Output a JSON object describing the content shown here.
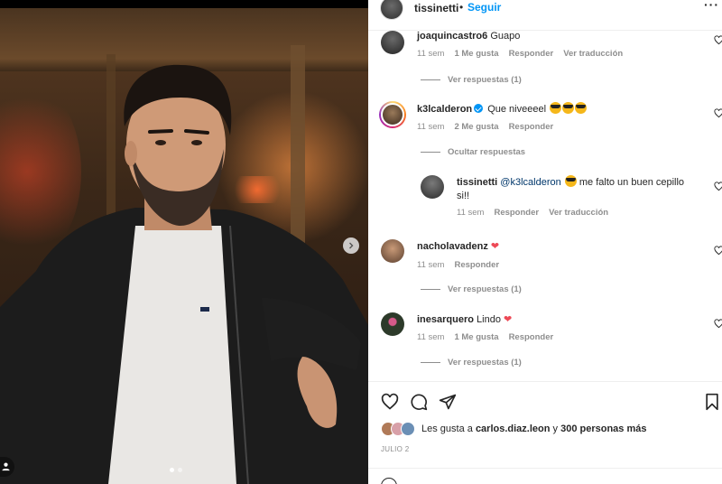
{
  "post": {
    "username": "tissinetti",
    "separator": "•",
    "follow_label": "Seguir",
    "more_label": "···",
    "carousel_dots": 2
  },
  "comments": [
    {
      "username": "joaquincastro6",
      "text": "Guapo",
      "time": "11 sem",
      "likes": "1 Me gusta",
      "reply": "Responder",
      "translate": "Ver traducción",
      "replies_toggle": "Ver respuestas (1)",
      "avatar_color": "#3b3b3b"
    },
    {
      "username": "k3lcalderon",
      "verified": true,
      "text": "Que niveeeel",
      "time": "11 sem",
      "likes": "2 Me gusta",
      "reply": "Responder",
      "replies_toggle": "Ocultar respuestas",
      "avatar_color": "#5a4a3a",
      "reply_item": {
        "username": "tissinetti",
        "mention": "@k3lcalderon",
        "text": "me falto un buen cepillo",
        "text_line2": "si!!",
        "time": "11 sem",
        "reply": "Responder",
        "translate": "Ver traducción"
      }
    },
    {
      "username": "nacholavadenz",
      "text": "",
      "time": "11 sem",
      "reply": "Responder",
      "replies_toggle": "Ver respuestas (1)",
      "avatar_color": "#8c6a4e"
    },
    {
      "username": "inesarquero",
      "text": "Lindo",
      "time": "11 sem",
      "likes": "1 Me gusta",
      "reply": "Responder",
      "replies_toggle": "Ver respuestas (1)",
      "avatar_color": "#2d3a2a"
    }
  ],
  "likes": {
    "prefix": "Les gusta a",
    "first_user": "carlos.diaz.leon",
    "joiner": "y",
    "others": "300 personas más"
  },
  "date": "JULIO 2",
  "icons": {
    "like": "heart-icon",
    "comment": "comment-icon",
    "share": "send-icon",
    "save": "bookmark-icon"
  },
  "colors": {
    "accent": "#0095f6",
    "muted": "#8e8e8e",
    "heart": "#ed4956"
  }
}
